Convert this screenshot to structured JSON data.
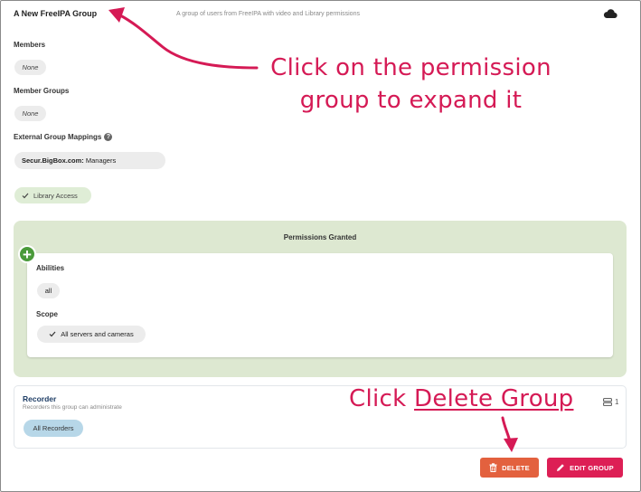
{
  "group": {
    "title": "A New FreeIPA Group",
    "description": "A group of users from FreeIPA with video and Library permissions",
    "cloud_icon": "cloud-icon"
  },
  "members": {
    "label": "Members",
    "value": "None"
  },
  "member_groups": {
    "label": "Member Groups",
    "value": "None"
  },
  "external_mappings": {
    "label": "External Group Mappings",
    "help_icon": "question-icon",
    "value_bold": "Secur.BigBox.com:",
    "value_rest": " Managers"
  },
  "library_access": {
    "label": "Library Access",
    "icon": "check-icon"
  },
  "permissions": {
    "title": "Permissions Granted",
    "add_icon": "plus-icon",
    "abilities_label": "Abilities",
    "abilities_value": "all",
    "scope_label": "Scope",
    "scope_value": "All servers and cameras",
    "scope_icon": "check-icon",
    "panel_color": "#dde8d1"
  },
  "recorder": {
    "title": "Recorder",
    "subtitle": "Recorders this group can administrate",
    "chip": "All Recorders",
    "count": "1",
    "count_icon": "server-icon"
  },
  "actions": {
    "delete_label": "DELETE",
    "delete_icon": "trash-icon",
    "delete_color": "#e3613e",
    "edit_label": "EDIT GROUP",
    "edit_icon": "pencil-icon",
    "edit_color": "#dd1f55"
  },
  "annotations": {
    "expand_line1": "Click on the permission",
    "expand_line2": "group to expand it",
    "delete_prefix": "Click ",
    "delete_link": "Delete Group",
    "color": "#d51a55"
  }
}
